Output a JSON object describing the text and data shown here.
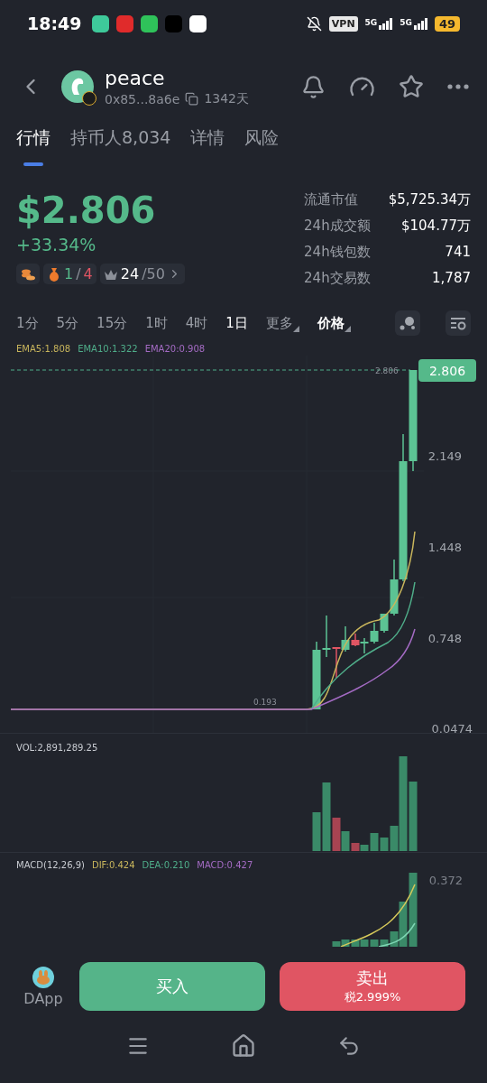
{
  "status_bar": {
    "time": "18:49",
    "vpn": "VPN",
    "networks": [
      "5G",
      "5G"
    ],
    "battery": "49"
  },
  "header": {
    "name": "peace",
    "address": "0x85...8a6e",
    "age": "1342天"
  },
  "tabs": [
    {
      "label": "行情",
      "selected": true
    },
    {
      "label": "持币人8,034",
      "selected": false
    },
    {
      "label": "详情",
      "selected": false
    },
    {
      "label": "风险",
      "selected": false
    }
  ],
  "price": {
    "value": "$2.806",
    "change": "+33.34%"
  },
  "badges": {
    "ratio_good": "1",
    "ratio_sep": "/",
    "ratio_bad": "4",
    "rank": "24",
    "rank_total": "/50"
  },
  "stats": [
    {
      "label": "流通市值",
      "value": "$5,725.34万"
    },
    {
      "label": "24h成交额",
      "value": "$104.77万"
    },
    {
      "label": "24h钱包数",
      "value": "741"
    },
    {
      "label": "24h交易数",
      "value": "1,787"
    }
  ],
  "timeframes": [
    {
      "label": "1分",
      "kind": "interval",
      "selected": false
    },
    {
      "label": "5分",
      "kind": "interval",
      "selected": false
    },
    {
      "label": "15分",
      "kind": "interval",
      "selected": false
    },
    {
      "label": "1时",
      "kind": "interval",
      "selected": false
    },
    {
      "label": "4时",
      "kind": "interval",
      "selected": false
    },
    {
      "label": "1日",
      "kind": "interval",
      "selected": true
    },
    {
      "label": "更多",
      "kind": "dropdown",
      "selected": false
    },
    {
      "label": "价格",
      "kind": "dropdown",
      "selected": true
    }
  ],
  "ema_legend": [
    {
      "label": "EMA5:1.808",
      "color": "#c9b65c"
    },
    {
      "label": "EMA10:1.322",
      "color": "#4fae8a"
    },
    {
      "label": "EMA20:0.908",
      "color": "#a46bc4"
    }
  ],
  "chart": {
    "price_tag": "2.806",
    "last_price_label": "2.806",
    "low_label": "0.193",
    "y_axis": [
      "2.149",
      "1.448",
      "0.748",
      "0.0474"
    ]
  },
  "volume": {
    "legend": "VOL:2,891,289.25"
  },
  "macd": {
    "legend": [
      {
        "label": "MACD(12,26,9)",
        "color": "#c9ccd2"
      },
      {
        "label": "DIF:0.424",
        "color": "#c9b65c"
      },
      {
        "label": "DEA:0.210",
        "color": "#4fae8a"
      },
      {
        "label": "MACD:0.427",
        "color": "#a46bc4"
      }
    ],
    "axis_label": "0.372"
  },
  "bottom": {
    "dapp": "DApp",
    "buy": "买入",
    "sell": "卖出",
    "tax": "税2.999%"
  }
}
